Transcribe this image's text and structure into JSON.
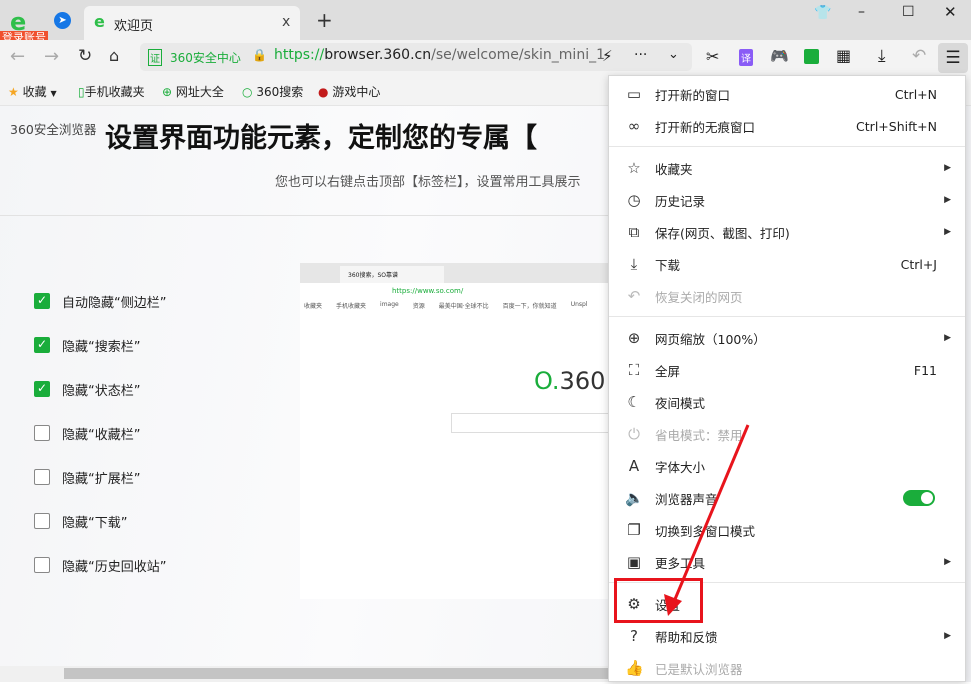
{
  "tabbar": {
    "login_badge": "登录账号",
    "tab_title": "欢迎页",
    "close": "x",
    "new_tab": "+"
  },
  "toolbar": {
    "security_label": "360安全中心",
    "url_scheme": "https://",
    "url_host": "browser.360.cn",
    "url_path": "/se/welcome/skin_mini_1",
    "ext_translate": "译"
  },
  "bookmarks": [
    {
      "label": "收藏"
    },
    {
      "label": "手机收藏夹"
    },
    {
      "label": "网址大全"
    },
    {
      "label": "360搜索"
    },
    {
      "label": "游戏中心"
    }
  ],
  "page": {
    "brand": "360安全浏览器",
    "title": "设置界面功能元素，定制您的专属【",
    "subtitle": "您也可以右键点击顶部【标签栏】，设置常用工具展示",
    "options": [
      {
        "label": "自动隐藏“侧边栏”",
        "checked": true
      },
      {
        "label": "隐藏“搜索栏”",
        "checked": true
      },
      {
        "label": "隐藏“状态栏”",
        "checked": true
      },
      {
        "label": "隐藏“收藏栏”",
        "checked": false
      },
      {
        "label": "隐藏“扩展栏”",
        "checked": false
      },
      {
        "label": "隐藏“下载”",
        "checked": false
      },
      {
        "label": "隐藏“历史回收站”",
        "checked": false
      }
    ],
    "preview": {
      "tab": "360搜索，SO靠谱",
      "url": "https://www.so.com/",
      "bookmarks": [
        "收藏夹",
        "手机收藏夹",
        "image",
        "资源",
        "最美中国·全球不比",
        "百度一下，你就知道",
        "Unspl"
      ],
      "logo": "360"
    }
  },
  "menu": {
    "items": [
      {
        "icon": "window-icon",
        "glyph": "▭",
        "label": "打开新的窗口",
        "shortcut": "Ctrl+N"
      },
      {
        "icon": "incognito-icon",
        "glyph": "∞",
        "label": "打开新的无痕窗口",
        "shortcut": "Ctrl+Shift+N"
      },
      {
        "icon": "favorites-icon",
        "glyph": "☆",
        "label": "收藏夹",
        "arrow": true
      },
      {
        "icon": "history-icon",
        "glyph": "◷",
        "label": "历史记录",
        "arrow": true
      },
      {
        "icon": "save-icon",
        "glyph": "⧉",
        "label": "保存(网页、截图、打印)",
        "arrow": true
      },
      {
        "icon": "download-icon",
        "glyph": "⤓",
        "label": "下载",
        "shortcut": "Ctrl+J"
      },
      {
        "icon": "restore-icon",
        "glyph": "↶",
        "label": "恢复关闭的网页",
        "disabled": true
      },
      {
        "icon": "zoom-icon",
        "glyph": "⊕",
        "label": "网页缩放（100%）",
        "arrow": true
      },
      {
        "icon": "fullscreen-icon",
        "glyph": "⛶",
        "label": "全屏",
        "shortcut": "F11"
      },
      {
        "icon": "night-icon",
        "glyph": "☾",
        "label": "夜间模式"
      },
      {
        "icon": "power-icon",
        "glyph": "⏻",
        "label": "省电模式：禁用",
        "disabled": true
      },
      {
        "icon": "font-icon",
        "glyph": "A",
        "label": "字体大小"
      },
      {
        "icon": "sound-icon",
        "glyph": "🔈",
        "label": "浏览器声音",
        "toggle": true
      },
      {
        "icon": "multiwindow-icon",
        "glyph": "❐",
        "label": "切换到多窗口模式"
      },
      {
        "icon": "tools-icon",
        "glyph": "▣",
        "label": "更多工具",
        "arrow": true
      },
      {
        "icon": "gear-icon",
        "glyph": "⚙",
        "label": "设置"
      },
      {
        "icon": "help-icon",
        "glyph": "?",
        "label": "帮助和反馈",
        "arrow": true
      },
      {
        "icon": "thumb-icon",
        "glyph": "👍",
        "label": "已是默认浏览器",
        "disabled": true
      }
    ]
  },
  "colors": {
    "accent": "#1aad3b",
    "highlight": "#e8141c"
  }
}
